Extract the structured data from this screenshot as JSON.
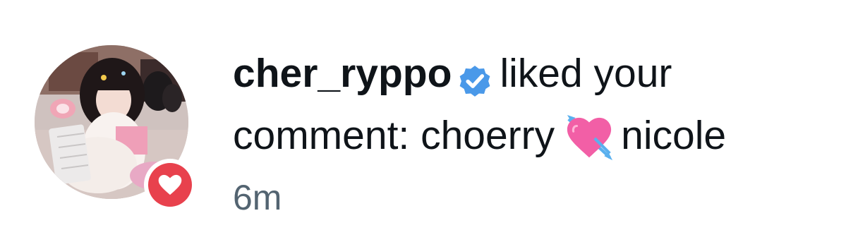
{
  "notification": {
    "type": "like",
    "username": "cher_ryppo",
    "verified": true,
    "action_line1": "liked your",
    "action_line2": "comment: choerry",
    "emoji": "💘",
    "comment_tail": "nicole",
    "timestamp": "6m",
    "colors": {
      "verified_badge": "#4a99e9",
      "like_badge": "#e8414d",
      "text": "#0f1419",
      "muted_text": "#536471",
      "emoji_heart": "#f25fa6",
      "emoji_arrow": "#5ab0ee"
    },
    "icons": {
      "badge": "heart-icon",
      "verified": "verified-badge-icon",
      "emoji": "heart-with-arrow-emoji"
    }
  }
}
